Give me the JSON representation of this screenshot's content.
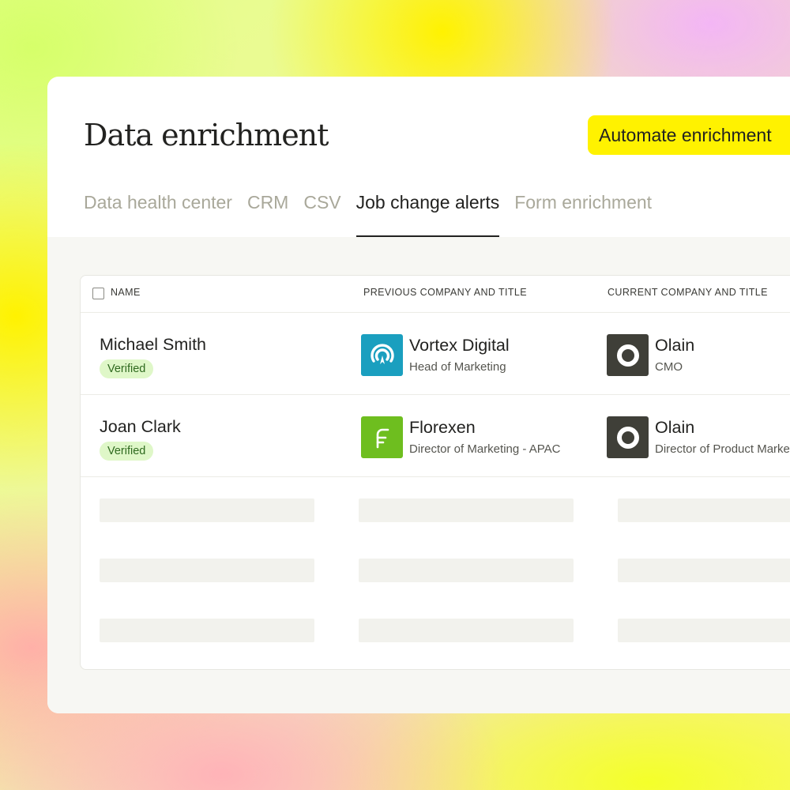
{
  "page": {
    "title": "Data enrichment",
    "automate_button": "Automate enrichment"
  },
  "tabs": [
    {
      "label": "Data health center",
      "active": false
    },
    {
      "label": "CRM",
      "active": false
    },
    {
      "label": "CSV",
      "active": false
    },
    {
      "label": "Job change alerts",
      "active": true
    },
    {
      "label": "Form enrichment",
      "active": false
    }
  ],
  "table": {
    "columns": {
      "name": "NAME",
      "previous": "PREVIOUS COMPANY AND TITLE",
      "current": "CURRENT COMPANY AND TITLE"
    },
    "rows": [
      {
        "name": "Michael Smith",
        "badge": "Verified",
        "previous_company": "Vortex Digital",
        "previous_title": "Head of Marketing",
        "previous_logo": "vortex-logo-icon",
        "current_company": "Olain",
        "current_title": "CMO",
        "current_logo": "olain-logo-icon"
      },
      {
        "name": "Joan Clark",
        "badge": "Verified",
        "previous_company": "Florexen",
        "previous_title": "Director of Marketing - APAC",
        "previous_logo": "florexen-logo-icon",
        "current_company": "Olain",
        "current_title": "Director of Product Marketing",
        "current_logo": "olain-logo-icon"
      }
    ]
  },
  "colors": {
    "accent_button": "#fff200",
    "verified_bg": "#dff7c8",
    "verified_text": "#2f6a1f",
    "vortex_logo": "#1a9fbf",
    "florexen_logo": "#6ebe1f",
    "olain_logo": "#3f3f38"
  }
}
